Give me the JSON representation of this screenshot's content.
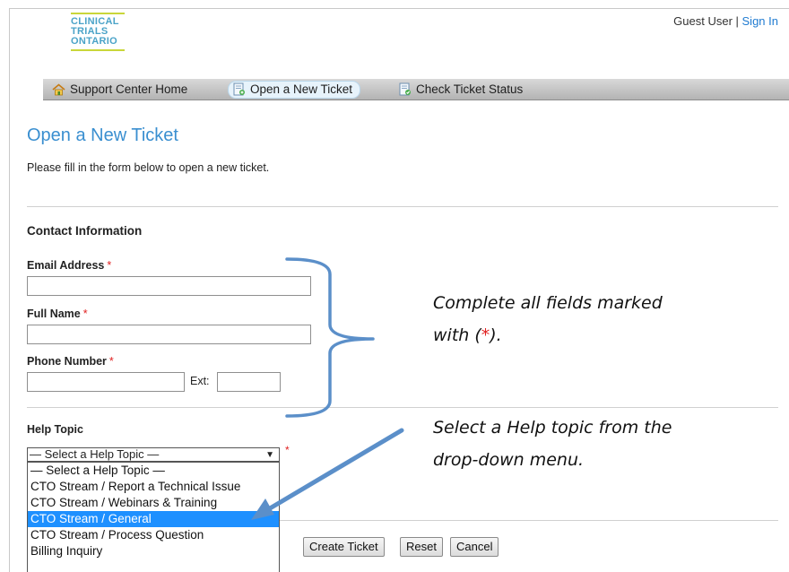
{
  "header": {
    "logo": [
      "CLINICAL",
      "TRIALS",
      "ONTARIO"
    ],
    "guest_label": "Guest User",
    "separator": " | ",
    "sign_in": "Sign In"
  },
  "nav": {
    "items": [
      {
        "label": "Support Center Home",
        "icon": "home-icon"
      },
      {
        "label": "Open a New Ticket",
        "icon": "new-ticket-icon"
      },
      {
        "label": "Check Ticket Status",
        "icon": "ticket-status-icon"
      }
    ]
  },
  "page": {
    "title": "Open a New Ticket",
    "intro": "Please fill in the form below to open a new ticket."
  },
  "contact": {
    "heading": "Contact Information",
    "email_label": "Email Address",
    "name_label": "Full Name",
    "phone_label": "Phone Number",
    "ext_label": "Ext:",
    "required_mark": "*"
  },
  "help": {
    "heading": "Help Topic",
    "selected": "— Select a Help Topic —",
    "options": [
      "— Select a Help Topic —",
      "CTO Stream / Report a Technical Issue",
      "CTO Stream / Webinars & Training",
      "CTO Stream / General",
      "CTO Stream / Process Question",
      "Billing Inquiry"
    ],
    "highlighted_index": 3
  },
  "buttons": {
    "create": "Create Ticket",
    "reset": "Reset",
    "cancel": "Cancel"
  },
  "annotations": {
    "fields_line1": "Complete all fields marked",
    "fields_line2_pre": "with (",
    "fields_line2_star": "*",
    "fields_line2_post": ").",
    "topic_line1": "Select a Help topic from the",
    "topic_line2": "drop-down menu."
  },
  "colors": {
    "accent": "#3a8fd0",
    "required": "#e02020",
    "annotation_shape": "#5b8fc9",
    "dropdown_highlight": "#1e90ff"
  }
}
